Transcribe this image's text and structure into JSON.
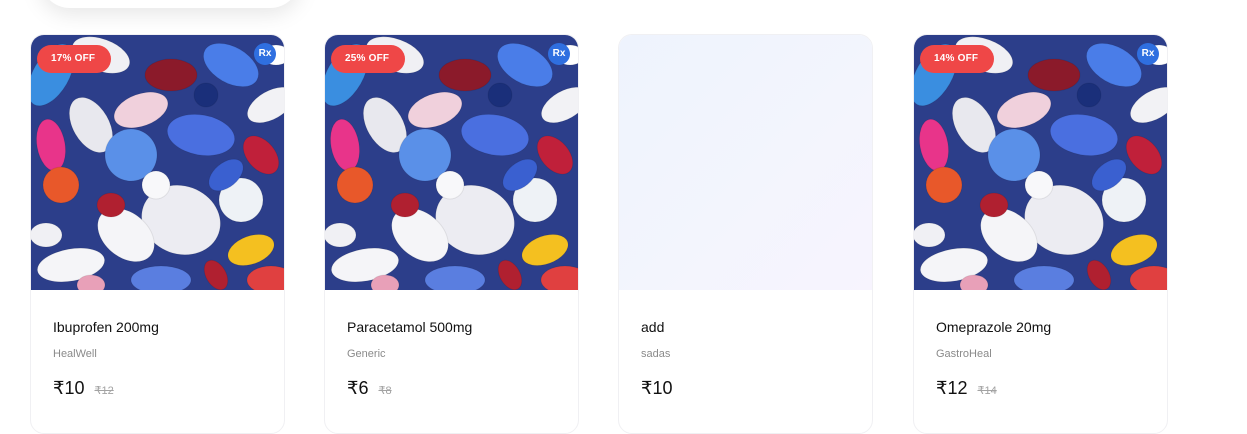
{
  "products": [
    {
      "name": "Ibuprofen 200mg",
      "brand": "HealWell",
      "price": "₹10",
      "mrp": "₹12",
      "discount": "17% OFF",
      "rx": "Rx",
      "image": "pills-photo"
    },
    {
      "name": "Paracetamol 500mg",
      "brand": "Generic",
      "price": "₹6",
      "mrp": "₹8",
      "discount": "25% OFF",
      "rx": "Rx",
      "image": "pills-photo"
    },
    {
      "name": "add",
      "brand": "sadas",
      "price": "₹10",
      "mrp": "",
      "discount": "",
      "rx": "",
      "image": "placeholder"
    },
    {
      "name": "Omeprazole 20mg",
      "brand": "GastroHeal",
      "price": "₹12",
      "mrp": "₹14",
      "discount": "14% OFF",
      "rx": "Rx",
      "image": "pills-photo"
    }
  ],
  "colors": {
    "discount_badge": "#ef4747",
    "rx_badge": "#2f6fe0"
  }
}
